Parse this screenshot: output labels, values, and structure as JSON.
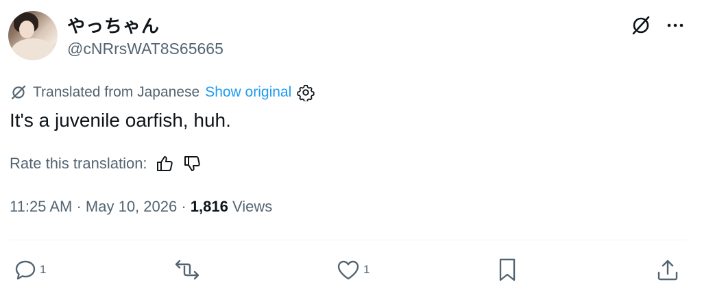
{
  "author": {
    "display_name": "やっちゃん",
    "handle": "@cNRrsWAT8S65665"
  },
  "translation": {
    "label": "Translated from Japanese",
    "show_original": "Show original"
  },
  "tweet": {
    "text": "It's a juvenile oarfish, huh."
  },
  "rate": {
    "label": "Rate this translation:"
  },
  "meta": {
    "time": "11:25 AM",
    "separator1": "·",
    "date": "May 10, 2026",
    "separator2": "·",
    "views_count": "1,816",
    "views_label": "Views"
  },
  "actions": {
    "reply_count": "1",
    "like_count": "1"
  },
  "icons": {
    "grok": "grok-icon",
    "more": "more-icon",
    "gear": "gear-icon",
    "thumbs_up": "thumbs-up-icon",
    "thumbs_down": "thumbs-down-icon",
    "reply": "reply-icon",
    "retweet": "retweet-icon",
    "like": "like-icon",
    "bookmark": "bookmark-icon",
    "share": "share-icon"
  },
  "colors": {
    "link": "#1d9bf0",
    "secondary_text": "#536471",
    "primary_text": "#0f1419"
  }
}
